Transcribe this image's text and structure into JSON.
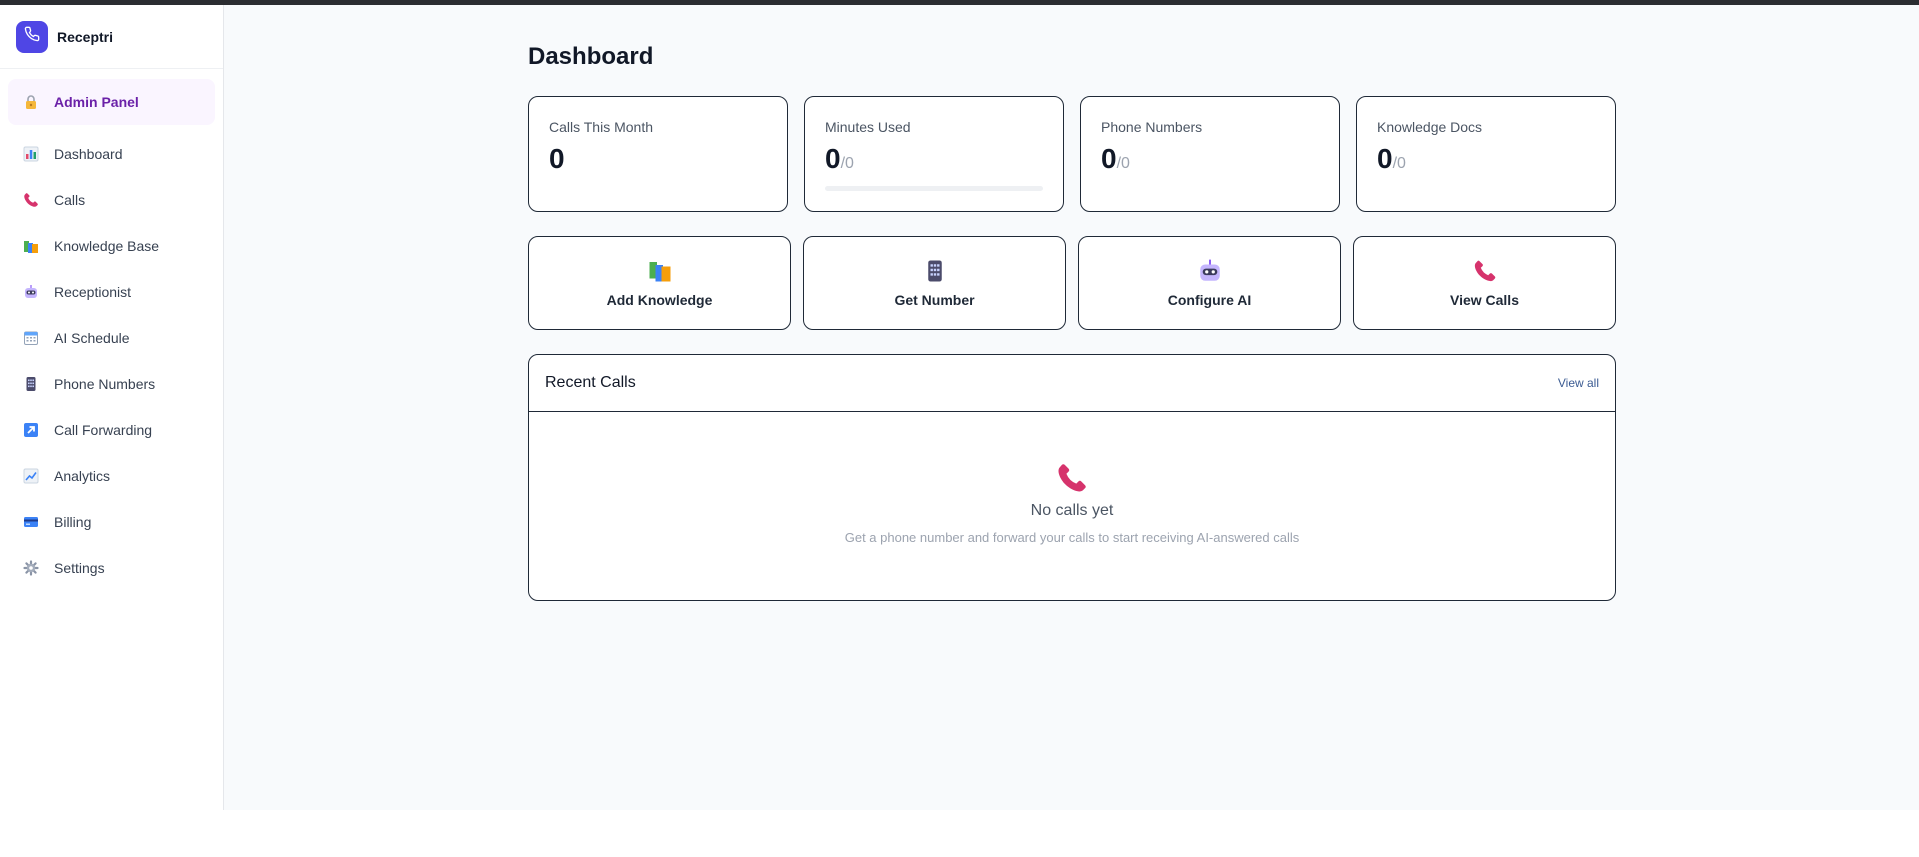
{
  "brand": {
    "name": "Receptri"
  },
  "sidebar": {
    "admin": {
      "label": "Admin Panel",
      "icon": "lock-icon"
    },
    "items": [
      {
        "label": "Dashboard",
        "icon": "bar-chart-icon"
      },
      {
        "label": "Calls",
        "icon": "phone-icon"
      },
      {
        "label": "Knowledge Base",
        "icon": "books-icon"
      },
      {
        "label": "Receptionist",
        "icon": "robot-icon"
      },
      {
        "label": "AI Schedule",
        "icon": "calendar-icon"
      },
      {
        "label": "Phone Numbers",
        "icon": "mobile-phone-icon"
      },
      {
        "label": "Call Forwarding",
        "icon": "arrow-up-right-icon"
      },
      {
        "label": "Analytics",
        "icon": "trend-chart-icon"
      },
      {
        "label": "Billing",
        "icon": "credit-card-icon"
      },
      {
        "label": "Settings",
        "icon": "gear-icon"
      }
    ]
  },
  "page": {
    "title": "Dashboard"
  },
  "stats": [
    {
      "label": "Calls This Month",
      "value": "0",
      "suffix": ""
    },
    {
      "label": "Minutes Used",
      "value": "0",
      "suffix": "/0",
      "progress": 0
    },
    {
      "label": "Phone Numbers",
      "value": "0",
      "suffix": "/0"
    },
    {
      "label": "Knowledge Docs",
      "value": "0",
      "suffix": "/0"
    }
  ],
  "actions": [
    {
      "label": "Add Knowledge",
      "icon": "books-icon"
    },
    {
      "label": "Get Number",
      "icon": "mobile-phone-icon"
    },
    {
      "label": "Configure AI",
      "icon": "robot-icon"
    },
    {
      "label": "View Calls",
      "icon": "phone-icon"
    }
  ],
  "recent_calls": {
    "title": "Recent Calls",
    "view_all": "View all",
    "empty_title": "No calls yet",
    "empty_subtitle": "Get a phone number and forward your calls to start receiving AI-answered calls",
    "empty_icon": "phone-icon"
  },
  "colors": {
    "brand": "#4f46e5",
    "admin_bg": "#faf5ff",
    "admin_text": "#6b21a8",
    "phone_pink": "#d6336c",
    "page_bg": "#f8fafc"
  }
}
